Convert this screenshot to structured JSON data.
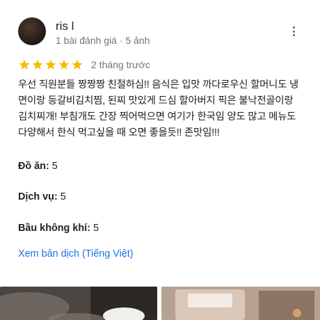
{
  "reviewer": {
    "name": "ris l",
    "meta": "1 bài đánh giá · 5 ảnh"
  },
  "review": {
    "rating": 5,
    "max_rating": 5,
    "date": "2 tháng trước",
    "text": "우선 직원분들 짱짱짱 친절하심!! 음식은 입맛 까다로우신 할머니도 냉면이랑 등갈비김치찜, 된찌 맛있게 드심 할아버지 픽은 불낙전골이랑 김치찌개! 부침개도 간장 찍어먹으면 여기가 한국임 양도 많고 메뉴도 다양해서 한식 먹고싶을 때 오면 좋을듯!! 존맛임!!!",
    "attributes": [
      {
        "label": "Đồ ăn:",
        "value": "5"
      },
      {
        "label": "Dịch vụ:",
        "value": "5"
      },
      {
        "label": "Bầu không khí:",
        "value": "5"
      }
    ],
    "translate_link": "Xem bản dịch (Tiếng Việt)"
  },
  "colors": {
    "star": "#fbbc04",
    "link": "#1a73e8",
    "meta": "#70757a"
  },
  "icons": {
    "more": "more-vert-icon",
    "star": "star-icon"
  }
}
